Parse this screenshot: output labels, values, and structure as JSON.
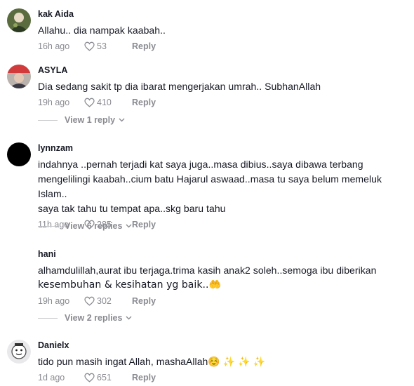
{
  "comments": [
    {
      "username": "kak Aida",
      "text": "Allahu.. dia nampak kaabah..",
      "time": "16h ago",
      "likes": "53",
      "reply_label": "Reply"
    },
    {
      "username": "ASYLA",
      "text": "Dia sedang sakit tp dia ibarat mengerjakan umrah.. SubhanAllah",
      "time": "19h ago",
      "likes": "410",
      "reply_label": "Reply",
      "view_replies": "View 1 reply"
    },
    {
      "username": "lynnzam",
      "text_lines": [
        "indahnya ..pernah terjadi kat saya juga..masa dibius..saya dibawa terbang",
        "mengelilingi kaabah..cium batu Hajarul aswaad..masa tu saya belum memeluk Islam..",
        "saya tak tahu tu tempat apa..skg baru tahu"
      ],
      "time": "11h ago",
      "likes": "285",
      "reply_label": "Reply",
      "view_replies": "View 6 replies"
    },
    {
      "username": "hani",
      "text_lines": [
        "alhamdulillah,aurat ibu terjaga.trima kasih anak2 soleh..semoga ibu diberikan",
        "kesembuhan & kesihatan yg baik..🤲"
      ],
      "time": "19h ago",
      "likes": "302",
      "reply_label": "Reply",
      "view_replies": "View 2 replies"
    },
    {
      "username": "Danielx",
      "text": "tido pun masih ingat Allah, mashaAllah☺️ ✨ ✨ ✨",
      "time": "1d ago",
      "likes": "651",
      "reply_label": "Reply"
    }
  ],
  "colors": {
    "text_primary": "#161823",
    "text_secondary": "#8a8b91"
  }
}
